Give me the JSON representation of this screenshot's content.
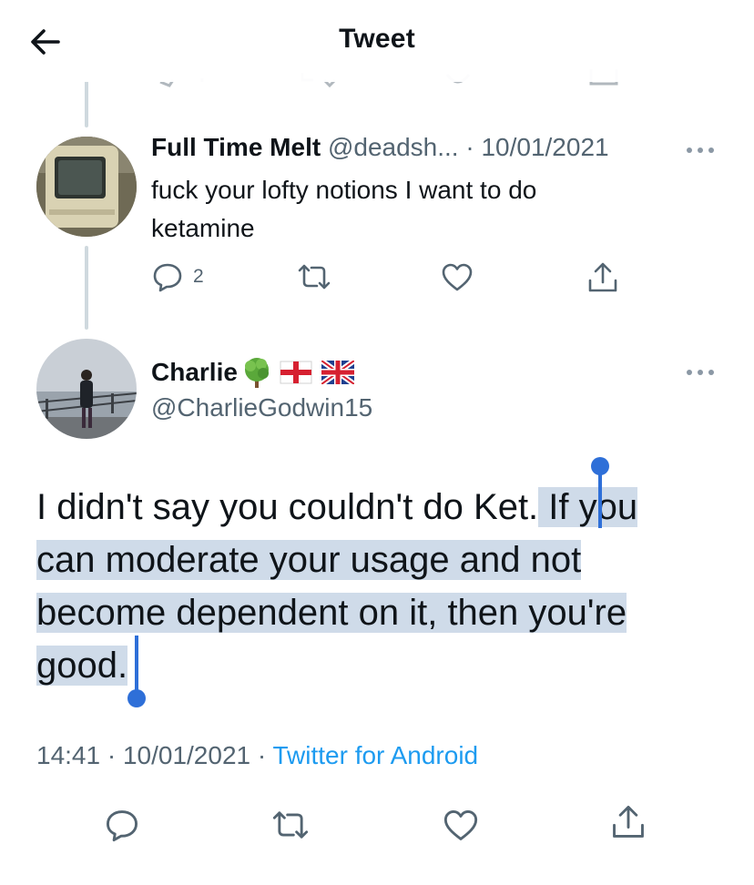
{
  "header": {
    "title": "Tweet",
    "back_icon": "arrow-left-icon"
  },
  "parent_tweet": {
    "name": "Full Time Melt",
    "handle": "@deadsh...",
    "date": "· 10/01/2021",
    "text_line1": "fuck your lofty notions I want to do",
    "text_line2": "ketamine",
    "reply_count": "2"
  },
  "main_tweet": {
    "name": "Charlie",
    "emojis": [
      "deciduous-tree",
      "england-flag",
      "union-jack-flag"
    ],
    "handle": "@CharlieGodwin15",
    "text_plain": "I didn't say you couldn't do Ket.",
    "text_selected_1": " If you",
    "text_selected_2": "can moderate your usage and not",
    "text_selected_3": "become dependent on it, then you're",
    "text_selected_4": "good.",
    "time": "14:41 · 10/01/2021 · ",
    "source": "Twitter for Android"
  },
  "colors": {
    "accent": "#1d9bf0",
    "selection": "#cfdbe9",
    "selection_handle": "#2e6fd8",
    "muted": "#536471"
  }
}
